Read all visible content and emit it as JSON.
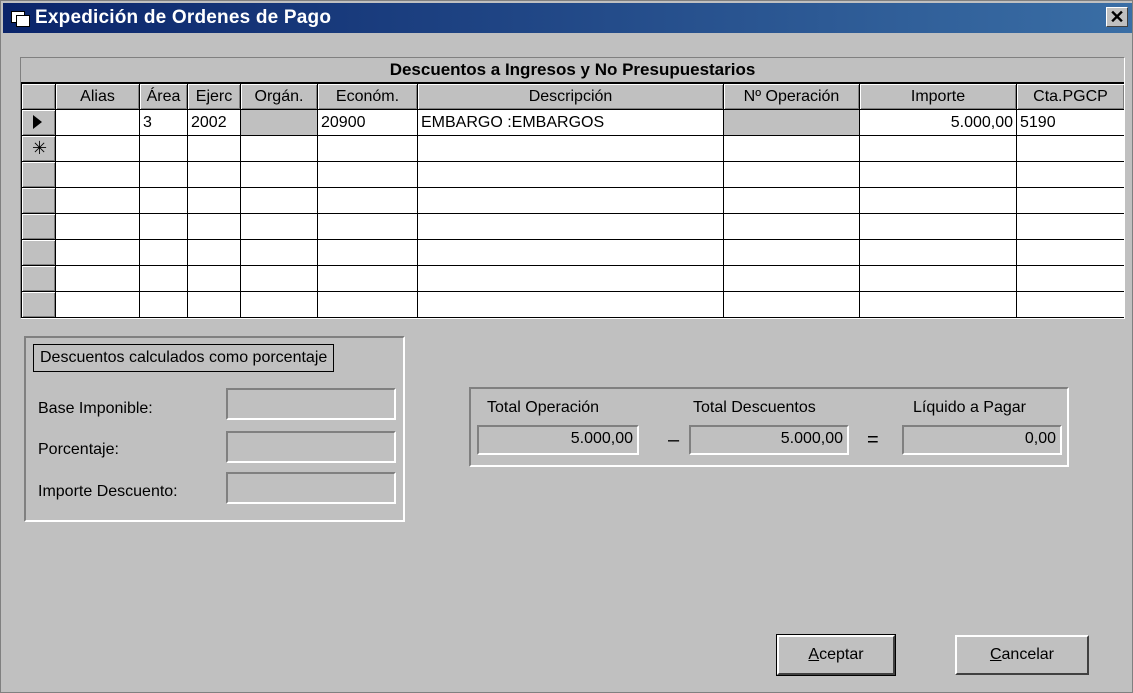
{
  "window": {
    "title": "Expedición de Ordenes de Pago",
    "close_label": "✕"
  },
  "grid": {
    "caption": "Descuentos a Ingresos y No Presupuestarios",
    "columns": [
      "",
      "Alias",
      "Área",
      "Ejerc",
      "Orgán.",
      "Económ.",
      "Descripción",
      "Nº Operación",
      "Importe",
      "Cta.PGCP"
    ],
    "rows": [
      {
        "alias": "",
        "area": "3",
        "ejerc": "2002",
        "organ": "",
        "econom": "20900",
        "descripcion": "EMBARGO :EMBARGOS",
        "operacion": "",
        "importe": "5.000,00",
        "cta": "5190"
      }
    ]
  },
  "percent_panel": {
    "title": "Descuentos calculados como porcentaje",
    "base_label": "Base Imponible:",
    "base_value": "",
    "porcentaje_label": "Porcentaje:",
    "porcentaje_value": "",
    "importe_label": "Importe Descuento:",
    "importe_value": ""
  },
  "totals": {
    "operacion_label": "Total Operación",
    "operacion_value": "5.000,00",
    "descuentos_label": "Total Descuentos",
    "descuentos_value": "5.000,00",
    "liquido_label": "Líquido a Pagar",
    "liquido_value": "0,00",
    "minus": "–",
    "equals": "="
  },
  "buttons": {
    "accept_mnemonic": "A",
    "accept_rest": "ceptar",
    "cancel_mnemonic": "C",
    "cancel_rest": "ancelar"
  }
}
